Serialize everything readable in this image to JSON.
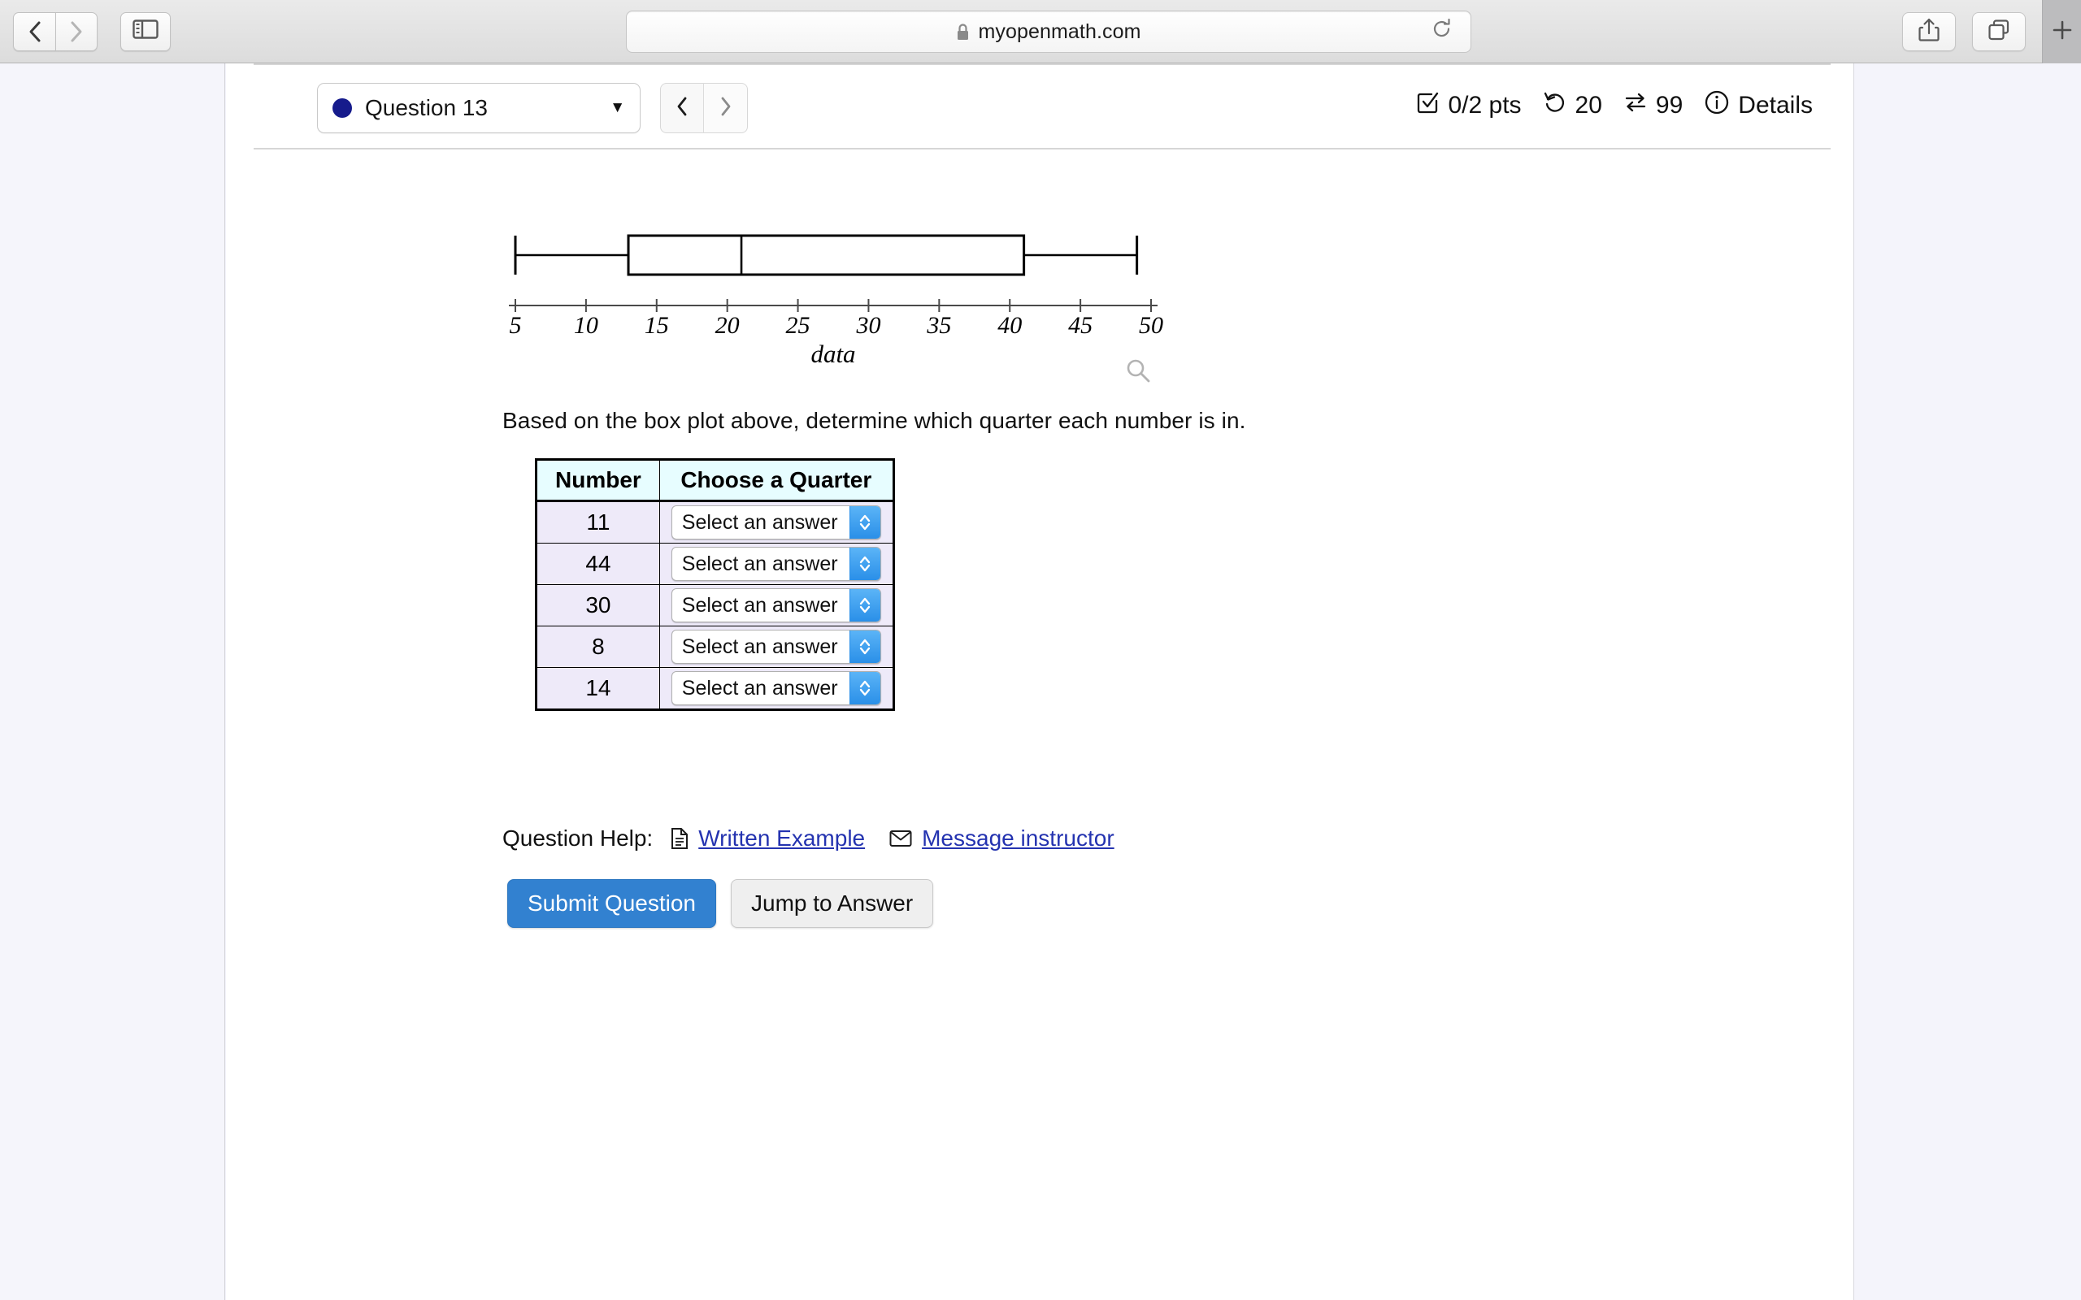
{
  "browser": {
    "url": "myopenmath.com",
    "back_icon": "chevron-left-icon",
    "forward_icon": "chevron-right-icon",
    "sidebar_icon": "sidebar-toggle-icon",
    "lock_icon": "lock-icon",
    "reload_icon": "reload-icon",
    "share_icon": "share-icon",
    "tabs_icon": "tab-overview-icon",
    "new_tab_label": "+"
  },
  "question_header": {
    "selected_question": "Question 13",
    "caret": "▼",
    "prev_label": "‹",
    "next_label": "›",
    "stats": [
      {
        "icon": "checkbox-icon",
        "label": "0/2 pts"
      },
      {
        "icon": "retry-icon",
        "label": "20"
      },
      {
        "icon": "swap-icon",
        "label": "99"
      },
      {
        "icon": "info-icon",
        "label": "Details"
      }
    ]
  },
  "chart_data": {
    "type": "boxplot",
    "title": "",
    "xlabel": "data",
    "ylabel": "",
    "xlim": [
      5,
      50
    ],
    "xticks": [
      5,
      10,
      15,
      20,
      25,
      30,
      35,
      40,
      45,
      50
    ],
    "xtick_labels": [
      "5",
      "10",
      "15",
      "20",
      "25",
      "30",
      "35",
      "40",
      "45",
      "50"
    ],
    "grid": false,
    "legend": "none",
    "series": [
      {
        "name": "data",
        "min": 5,
        "q1": 13,
        "median": 21,
        "q3": 41,
        "max": 49
      }
    ],
    "magnifier_icon": "zoom-icon"
  },
  "prompt": "Based on the box plot above, determine which quarter each number is in.",
  "table": {
    "headers": [
      "Number",
      "Choose a Quarter"
    ],
    "rows": [
      {
        "number": "11",
        "answer": "Select an answer"
      },
      {
        "number": "44",
        "answer": "Select an answer"
      },
      {
        "number": "30",
        "answer": "Select an answer"
      },
      {
        "number": "8",
        "answer": "Select an answer"
      },
      {
        "number": "14",
        "answer": "Select an answer"
      }
    ]
  },
  "help": {
    "label": "Question Help:",
    "links": [
      {
        "icon": "document-icon",
        "label": "Written Example"
      },
      {
        "icon": "envelope-icon",
        "label": "Message instructor"
      }
    ]
  },
  "actions": {
    "submit_label": "Submit Question",
    "jump_label": "Jump to Answer"
  },
  "colors": {
    "accent_blue": "#3281d0",
    "link_blue": "#2433b0",
    "dot_navy": "#161b8c",
    "table_header": "#e7fdff",
    "table_row": "#eeeaf9",
    "stepper_blue": "#2a8fe8"
  }
}
